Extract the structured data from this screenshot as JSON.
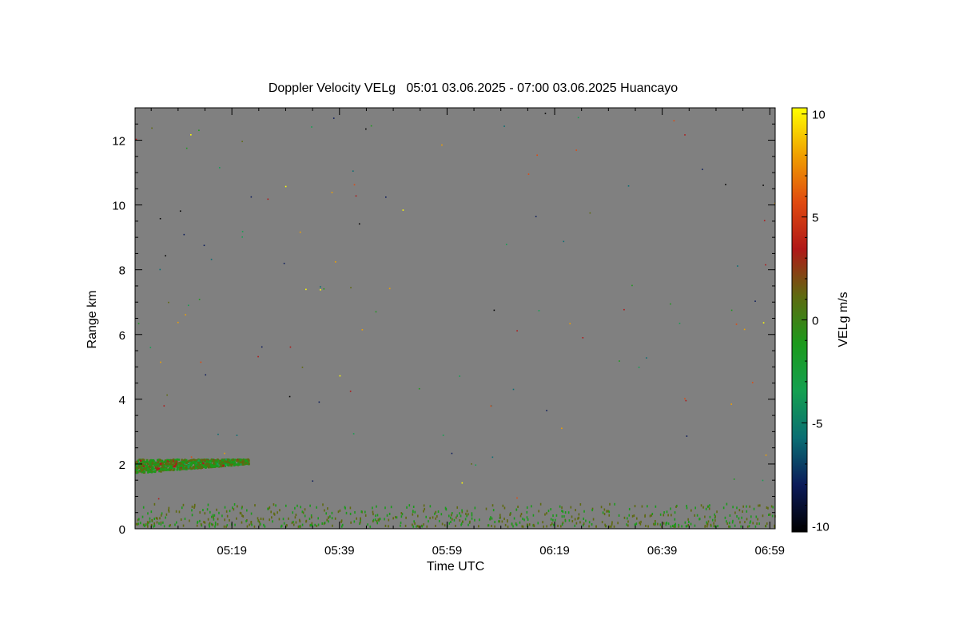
{
  "chart_data": {
    "type": "heatmap",
    "title": "Doppler Velocity VELg   05:01 03.06.2025 - 07:00 03.06.2025 Huancayo",
    "xlabel": "Time UTC",
    "ylabel": "Range km",
    "colorbar_label": "VELg m/s",
    "x_tick_labels": [
      "05:19",
      "05:39",
      "05:59",
      "06:19",
      "06:39",
      "06:59"
    ],
    "x_start": "05:01",
    "x_end": "07:00",
    "y_ticks": [
      0,
      2,
      4,
      6,
      8,
      10,
      12
    ],
    "ylim": [
      0,
      13
    ],
    "colorbar_ticks": [
      10,
      5,
      0,
      -5,
      -10
    ],
    "clim": [
      -10.3,
      10.3
    ],
    "colormap": [
      "#000000",
      "#0b1b5a",
      "#0a6e73",
      "#14a050",
      "#1c9a1c",
      "#5e6a10",
      "#b01818",
      "#e04a10",
      "#f0a000",
      "#ffff00"
    ],
    "background_color": "#808080",
    "features": [
      {
        "name": "cloud layer",
        "time_range": [
          "05:01",
          "05:22"
        ],
        "range_km": [
          1.8,
          2.2
        ],
        "velocity_range_ms": [
          -2.5,
          2.5
        ]
      },
      {
        "name": "near-surface clutter",
        "time_range": [
          "05:01",
          "07:00"
        ],
        "range_km": [
          0.1,
          0.8
        ],
        "velocity_range_ms": [
          -2,
          2
        ]
      }
    ]
  }
}
